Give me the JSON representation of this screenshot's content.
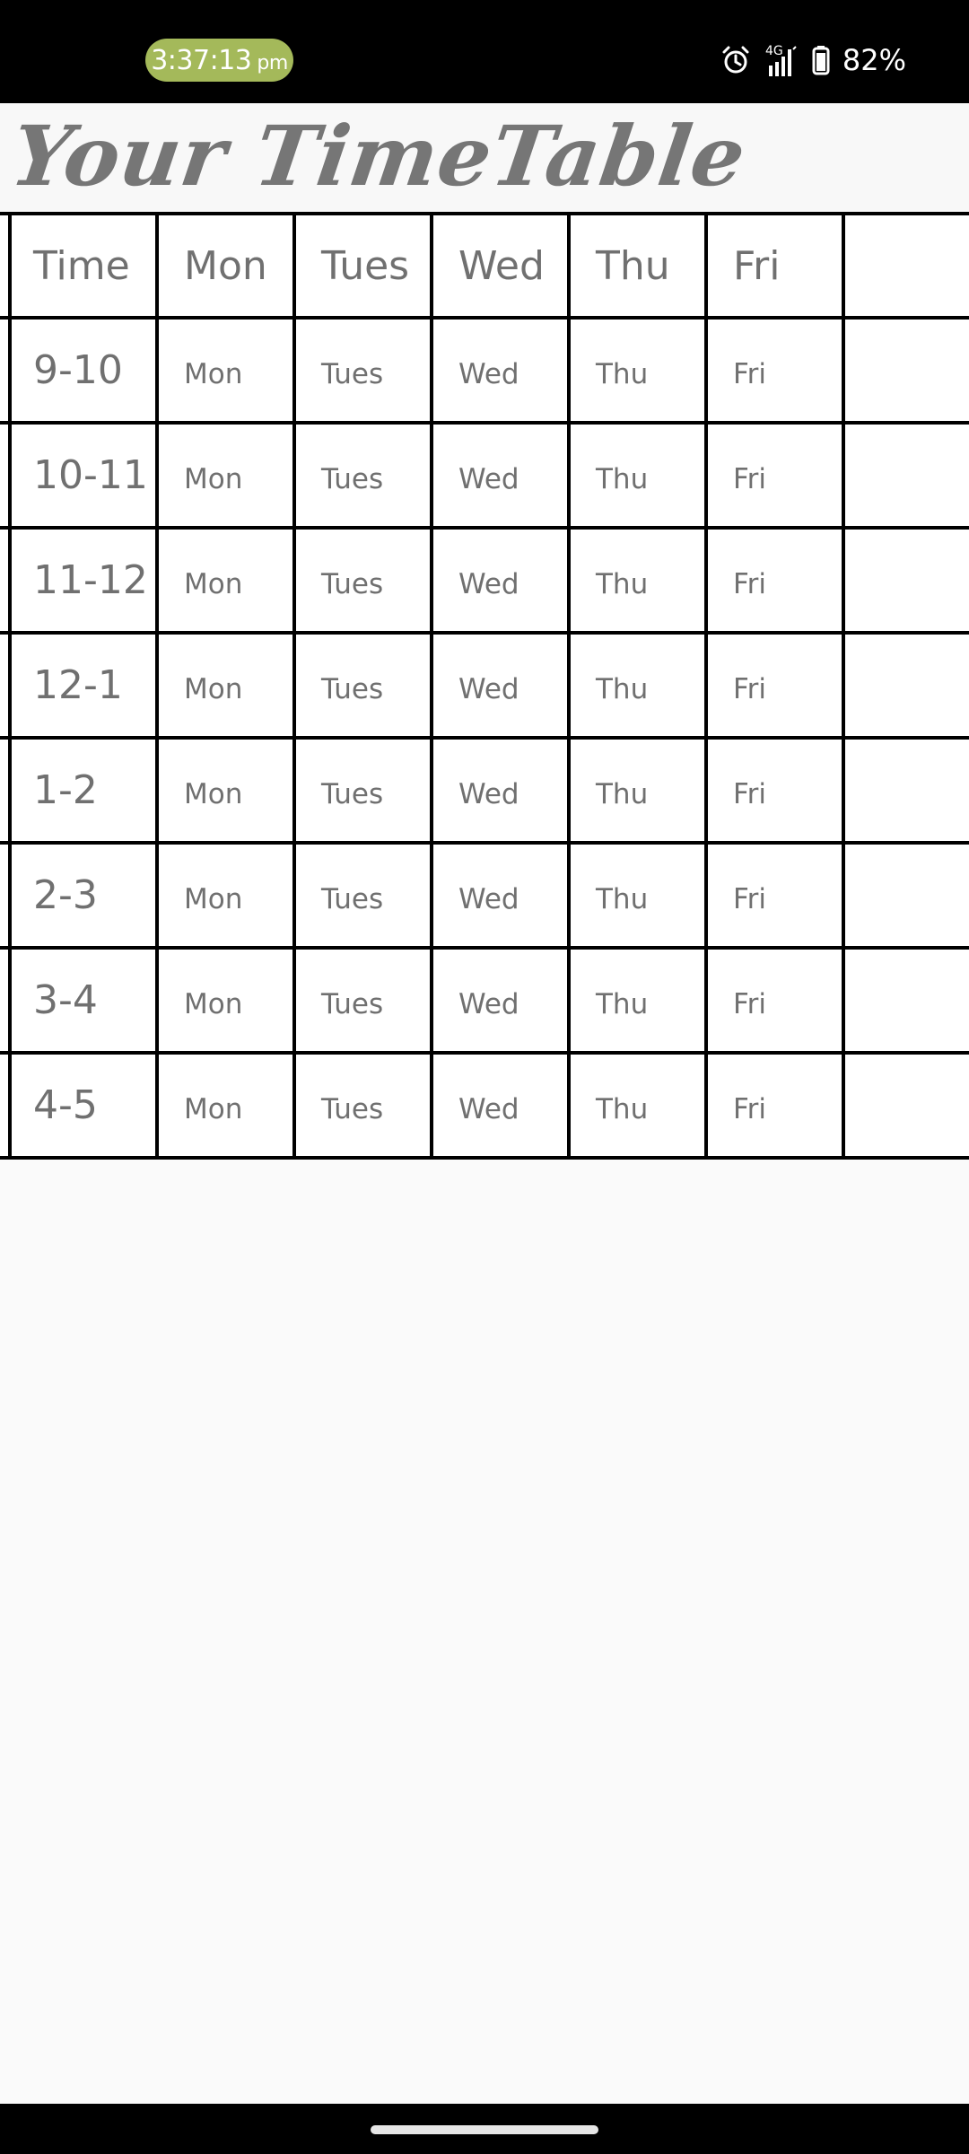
{
  "status_bar": {
    "time": "3:37:13",
    "ampm": "pm",
    "network": "4G",
    "battery": "82%",
    "icons": [
      "alarm-icon",
      "signal-4g-icon",
      "battery-icon"
    ]
  },
  "app": {
    "title": "Your TimeTable"
  },
  "timetable": {
    "header": [
      "Time",
      "Mon",
      "Tues",
      "Wed",
      "Thu",
      "Fri"
    ],
    "rows": [
      {
        "time": "9-10",
        "cells": [
          "Mon",
          "Tues",
          "Wed",
          "Thu",
          "Fri"
        ]
      },
      {
        "time": "10-11",
        "cells": [
          "Mon",
          "Tues",
          "Wed",
          "Thu",
          "Fri"
        ]
      },
      {
        "time": "11-12",
        "cells": [
          "Mon",
          "Tues",
          "Wed",
          "Thu",
          "Fri"
        ]
      },
      {
        "time": "12-1",
        "cells": [
          "Mon",
          "Tues",
          "Wed",
          "Thu",
          "Fri"
        ]
      },
      {
        "time": "1-2",
        "cells": [
          "Mon",
          "Tues",
          "Wed",
          "Thu",
          "Fri"
        ]
      },
      {
        "time": "2-3",
        "cells": [
          "Mon",
          "Tues",
          "Wed",
          "Thu",
          "Fri"
        ]
      },
      {
        "time": "3-4",
        "cells": [
          "Mon",
          "Tues",
          "Wed",
          "Thu",
          "Fri"
        ]
      },
      {
        "time": "4-5",
        "cells": [
          "Mon",
          "Tues",
          "Wed",
          "Thu",
          "Fri"
        ]
      }
    ]
  },
  "colors": {
    "clock_pill": "#a4b95a",
    "text_gray": "#707070",
    "grid": "#000000",
    "background": "#fafafa"
  }
}
